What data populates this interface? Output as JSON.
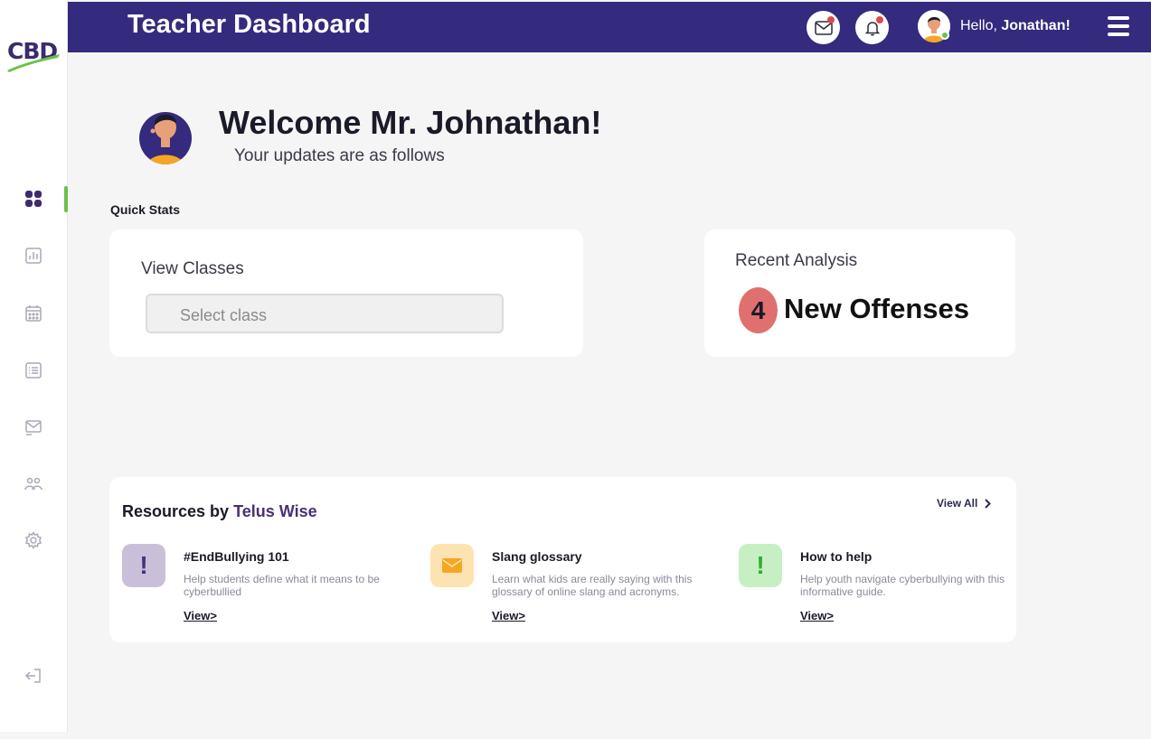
{
  "app": {
    "logo_text": "CBD",
    "title": "Teacher Dashboard",
    "greeting_prefix": "Hello, ",
    "user_name": "Jonathan!"
  },
  "sidebar": {
    "items": [
      {
        "icon": "dashboard-icon",
        "active": true
      },
      {
        "icon": "bar-chart-icon",
        "active": false
      },
      {
        "icon": "calendar-icon",
        "active": false
      },
      {
        "icon": "list-icon",
        "active": false
      },
      {
        "icon": "mail-icon",
        "active": false
      },
      {
        "icon": "users-icon",
        "active": false
      },
      {
        "icon": "settings-icon",
        "active": false
      }
    ],
    "logout_icon": "logout-icon"
  },
  "welcome": {
    "title": "Welcome Mr. Johnathan!",
    "subtitle": "Your updates are as follows"
  },
  "quick_stats": {
    "label": "Quick Stats",
    "classes": {
      "title": "View Classes",
      "placeholder": "Select class"
    },
    "analysis": {
      "title": "Recent Analysis",
      "count": "4",
      "label": "New Offenses"
    }
  },
  "resources": {
    "heading_prefix": "Resources by ",
    "brand": "Telus Wise",
    "view_all": "View All",
    "items": [
      {
        "title": "#EndBullying 101",
        "description": "Help students define what it means to be cyberbullied",
        "link": "View>",
        "icon_color": "#c9bfd9",
        "icon_glyph_color": "#4a2f78"
      },
      {
        "title": "Slang glossary",
        "description": "Learn what kids are really saying with this glossary of online slang and acronyms.",
        "link": "View>",
        "icon_color": "#fde3b1",
        "icon_glyph_color": "#f5a623"
      },
      {
        "title": "How to help",
        "description": "Help youth navigate cyberbullying with this informative guide.",
        "link": "View>",
        "icon_color": "#c7efc4",
        "icon_glyph_color": "#2eae2e"
      }
    ]
  },
  "colors": {
    "header": "#342a7e",
    "accent_green": "#6cc04a",
    "badge_red": "#e0706f"
  }
}
